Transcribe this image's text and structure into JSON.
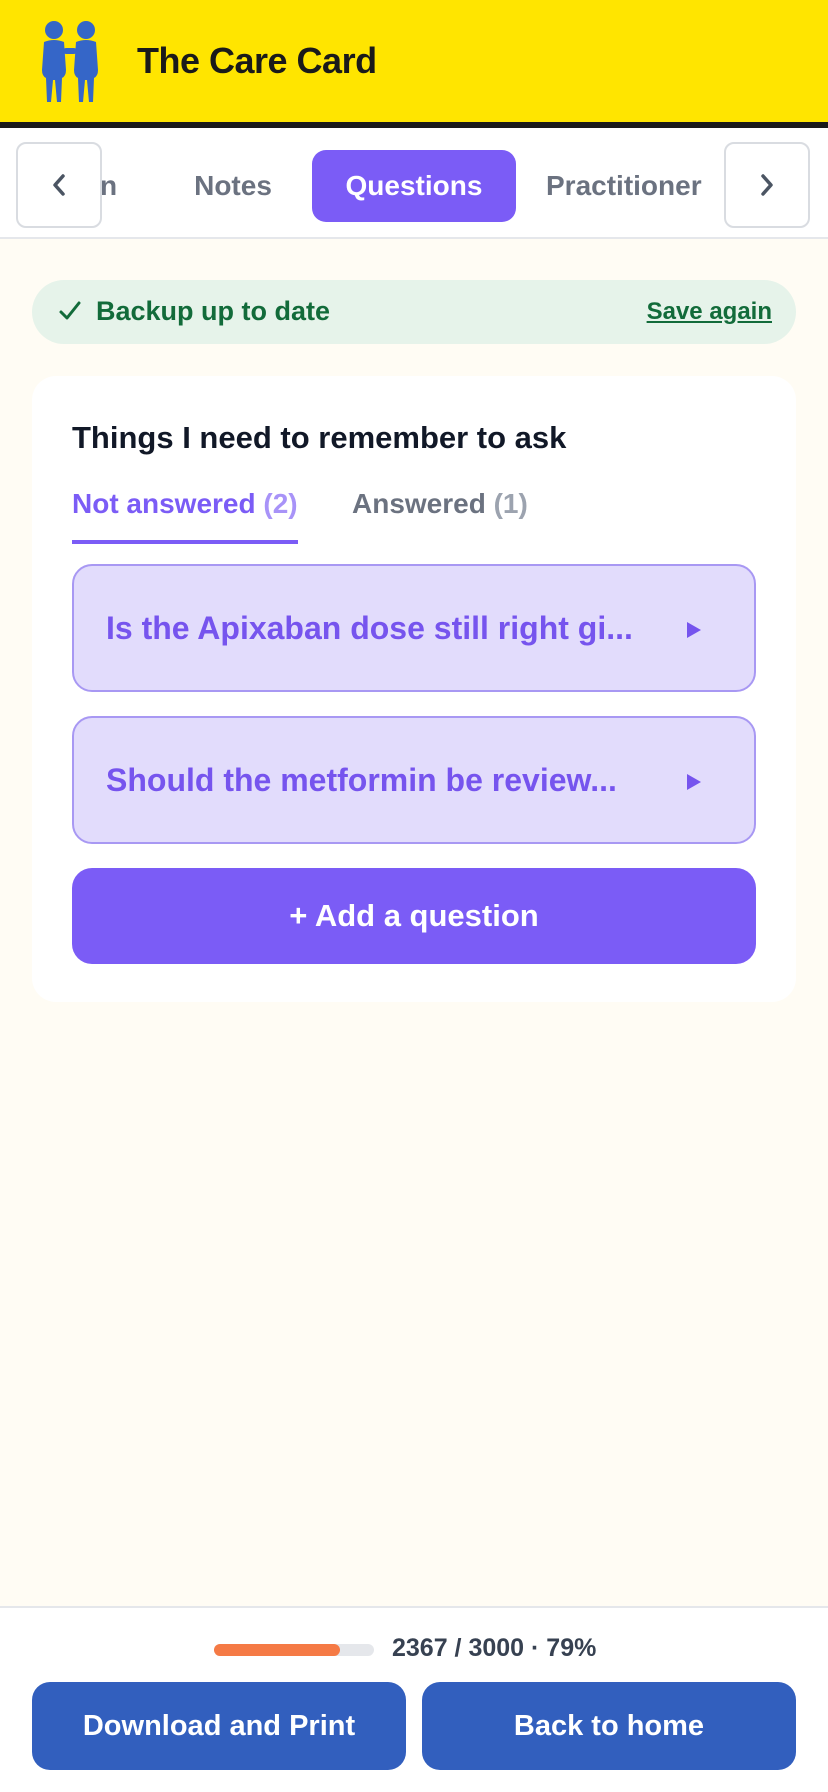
{
  "header": {
    "title": "The Care Card",
    "logo_icon": "two-people-icon",
    "background_color": "#FFE500"
  },
  "tabs": {
    "prev_icon": "chevron-left-icon",
    "next_icon": "chevron-right-icon",
    "items": [
      {
        "label": "n",
        "active": false
      },
      {
        "label": "Notes",
        "active": false
      },
      {
        "label": "Questions",
        "active": true
      },
      {
        "label": "Practitioner",
        "active": false
      }
    ],
    "accent_color": "#7B5CF6"
  },
  "backup": {
    "status_icon": "check-icon",
    "status_text": "Backup up to date",
    "action_label": "Save again"
  },
  "questions_card": {
    "title": "Things I need to remember to ask",
    "subtabs": [
      {
        "label": "Not answered",
        "count": "(2)",
        "active": true
      },
      {
        "label": "Answered",
        "count": "(1)",
        "active": false
      }
    ],
    "items": [
      {
        "text": "Is the Apixaban dose still right gi...",
        "icon": "play-triangle-icon"
      },
      {
        "text": "Should the metformin be review...",
        "icon": "play-triangle-icon"
      }
    ],
    "add_button_label": "+ Add a question"
  },
  "footer": {
    "progress_text": "2367 / 3000 · 79%",
    "progress_fraction": 0.79,
    "download_label": "Download and Print",
    "home_label": "Back to home"
  }
}
